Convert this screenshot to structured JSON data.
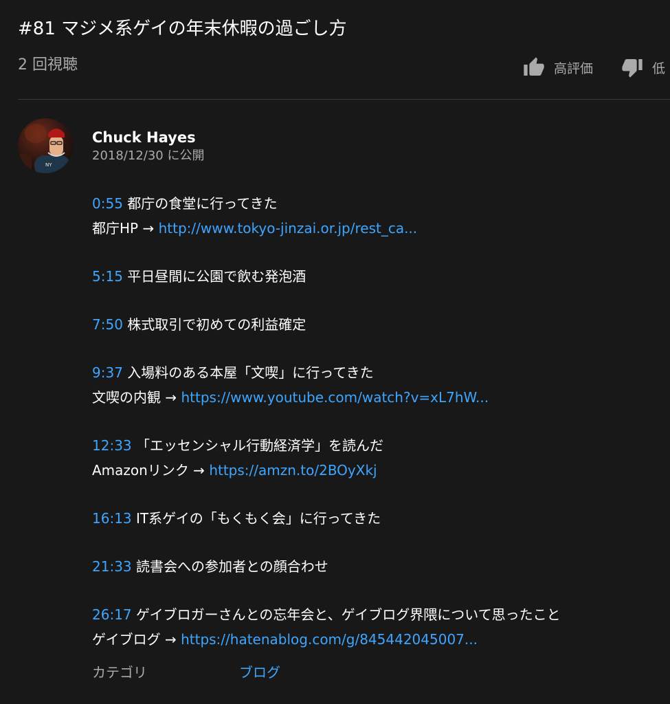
{
  "video": {
    "title": "#81 マジメ系ゲイの年末休暇の過ごし方",
    "views": "2 回視聴",
    "like_label": "高評価",
    "dislike_label": "低"
  },
  "channel": {
    "name": "Chuck Hayes",
    "published": "2018/12/30 に公開"
  },
  "description": {
    "blocks": [
      {
        "lines": [
          {
            "ts": "0:55",
            "text": " 都庁の食堂に行ってきた"
          },
          {
            "text": "都庁HP → ",
            "link": "http://www.tokyo-jinzai.or.jp/rest_ca..."
          }
        ]
      },
      {
        "lines": [
          {
            "ts": "5:15",
            "text": " 平日昼間に公園で飲む発泡酒"
          }
        ]
      },
      {
        "lines": [
          {
            "ts": "7:50",
            "text": " 株式取引で初めての利益確定"
          }
        ]
      },
      {
        "lines": [
          {
            "ts": "9:37",
            "text": " 入場料のある本屋「文喫」に行ってきた"
          },
          {
            "text": "文喫の内観 → ",
            "link": "https://www.youtube.com/watch?v=xL7hW..."
          }
        ]
      },
      {
        "lines": [
          {
            "ts": "12:33",
            "text": " 「エッセンシャル行動経済学」を読んだ"
          },
          {
            "text": "Amazonリンク → ",
            "link": "https://amzn.to/2BOyXkj"
          }
        ]
      },
      {
        "lines": [
          {
            "ts": "16:13",
            "text": " IT系ゲイの「もくもく会」に行ってきた"
          }
        ]
      },
      {
        "lines": [
          {
            "ts": "21:33",
            "text": " 読書会への参加者との顔合わせ"
          }
        ]
      },
      {
        "lines": [
          {
            "ts": "26:17",
            "text": " ゲイブロガーさんとの忘年会と、ゲイブログ界隈について思ったこと"
          },
          {
            "text": "ゲイブログ → ",
            "link": "https://hatenablog.com/g/845442045007..."
          }
        ]
      }
    ]
  },
  "category": {
    "label": "カテゴリ",
    "value": "ブログ"
  },
  "icons": {
    "like": "thumb-up-icon",
    "dislike": "thumb-down-icon"
  },
  "colors": {
    "background": "#181818",
    "link": "#3ea6ff",
    "secondary_text": "#aaaaaa",
    "divider": "#3a3a3a"
  }
}
